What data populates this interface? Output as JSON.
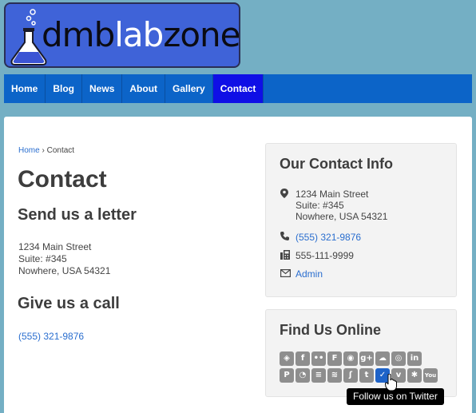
{
  "logo": {
    "text_a": "dmb",
    "text_b": "lab",
    "text_c": "zone"
  },
  "nav": {
    "items": [
      {
        "label": "Home"
      },
      {
        "label": "Blog"
      },
      {
        "label": "News"
      },
      {
        "label": "About"
      },
      {
        "label": "Gallery"
      },
      {
        "label": "Contact"
      }
    ],
    "active": "Contact"
  },
  "breadcrumb": {
    "home": "Home",
    "separator": "›",
    "current": "Contact"
  },
  "main": {
    "title": "Contact",
    "letter_heading": "Send us a letter",
    "address_line1": "1234 Main Street",
    "address_line2": "Suite: #345",
    "address_line3": "Nowhere, USA 54321",
    "call_heading": "Give us a call",
    "phone": "(555) 321-9876"
  },
  "contact_info": {
    "title": "Our Contact Info",
    "address_line1": "1234 Main Street",
    "address_line2": "Suite: #345",
    "address_line3": "Nowhere, USA 54321",
    "phone": "(555) 321-9876",
    "fax": "555-111-9999",
    "email": "Admin"
  },
  "find_us": {
    "title": "Find Us Online",
    "row1": [
      "codepen-icon",
      "facebook-icon",
      "flickr-icon",
      "foursquare-icon",
      "github-icon",
      "google-plus-icon",
      "cloud-icon",
      "instagram-icon",
      "linkedin-icon"
    ],
    "row2": [
      "pinterest-icon",
      "rss-icon",
      "stack-exchange-icon",
      "stack-overflow-icon",
      "stumbleupon-icon",
      "tumblr-icon",
      "twitter-icon",
      "vimeo-icon",
      "yelp-icon",
      "youtube-icon"
    ],
    "hovered": "twitter-icon",
    "tooltip": "Follow us on Twitter"
  },
  "colors": {
    "page_bg": "#74afc4",
    "nav_bg": "#0c64c8",
    "nav_active": "#0f0fe6",
    "link": "#2a6ecf",
    "logo_bg": "#3f63d8"
  }
}
